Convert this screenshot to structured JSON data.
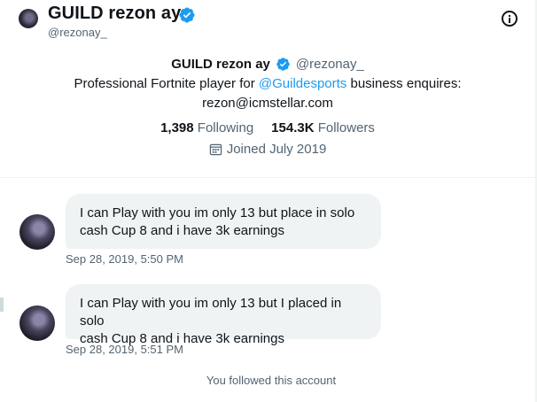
{
  "header": {
    "name": "GUILD rezon ay",
    "handle": "@rezonay_",
    "verified_icon": "verified-badge-icon",
    "info_icon": "info-icon"
  },
  "profile": {
    "name": "GUILD rezon ay",
    "handle": "@rezonay_",
    "bio_prefix": "Professional Fortnite player for ",
    "bio_mention": "@Guildesports",
    "bio_suffix": " business enquires:",
    "bio_email": "rezon@icmstellar.com",
    "following_count": "1,398",
    "following_label": "Following",
    "followers_count": "154.3K",
    "followers_label": "Followers",
    "joined": "Joined July 2019"
  },
  "messages": [
    {
      "text_line1": "I can Play with you im only 13 but place in solo",
      "text_line2": "cash Cup 8 and i have 3k earnings",
      "timestamp": "Sep 28, 2019, 5:50 PM"
    },
    {
      "text_line1": "I can Play with you im only 13 but I placed in solo",
      "text_line2": "cash Cup 8 and i have 3k earnings",
      "timestamp": "Sep 28, 2019, 5:51 PM"
    }
  ],
  "system_note": "You followed this account",
  "colors": {
    "accent": "#1d9bf0",
    "secondary_text": "#536471",
    "bubble_bg": "#eff3f4"
  }
}
